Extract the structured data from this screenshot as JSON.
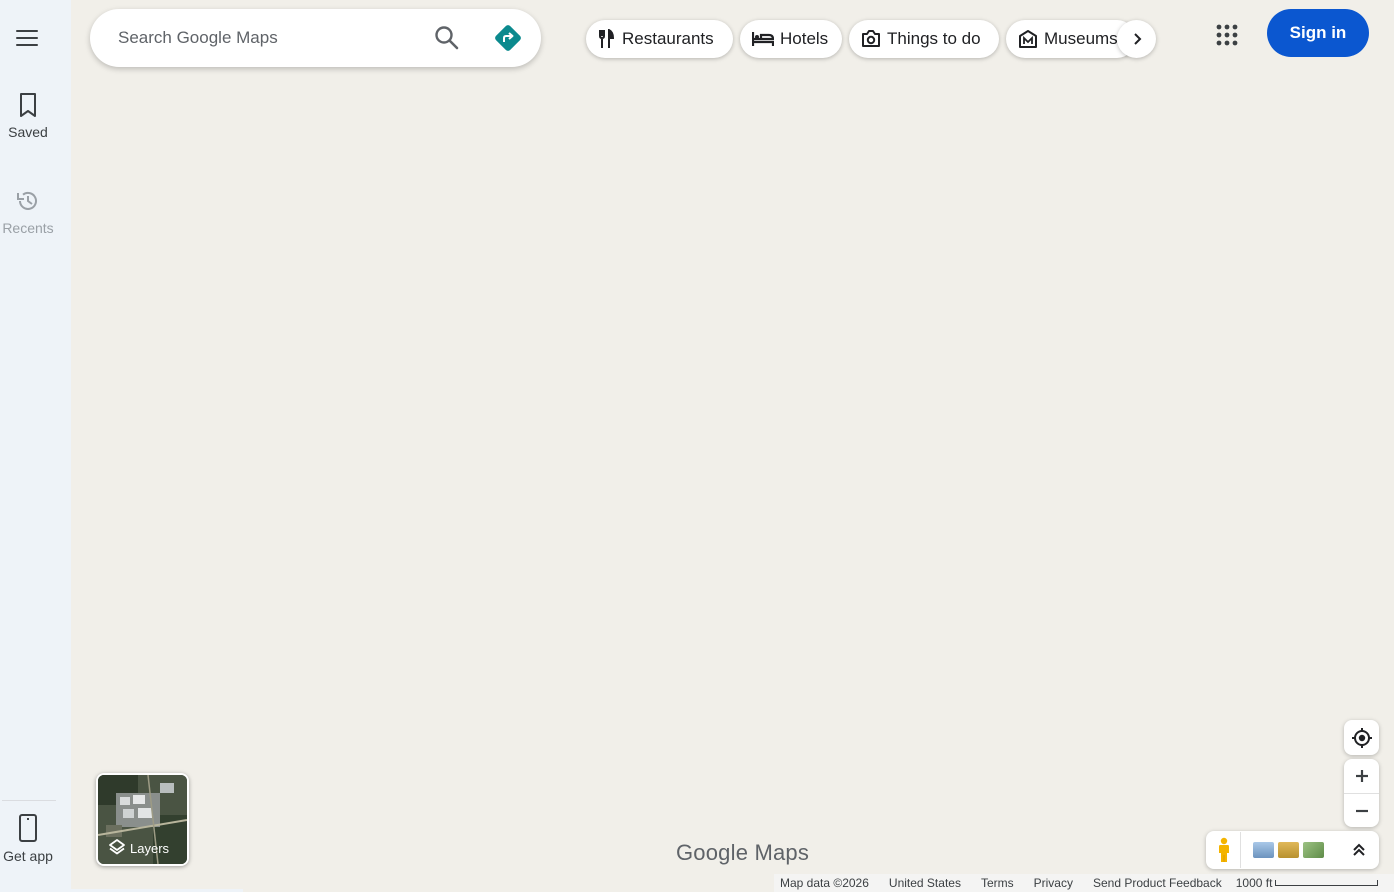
{
  "sidebar": {
    "saved_label": "Saved",
    "recents_label": "Recents",
    "getapp_label": "Get app"
  },
  "search": {
    "placeholder": "Search Google Maps"
  },
  "chips": [
    {
      "label": "Restaurants",
      "icon": "fork-knife-icon"
    },
    {
      "label": "Hotels",
      "icon": "bed-icon"
    },
    {
      "label": "Things to do",
      "icon": "camera-icon"
    },
    {
      "label": "Museums",
      "icon": "museum-icon"
    }
  ],
  "header": {
    "signin_label": "Sign in"
  },
  "layers": {
    "label": "Layers"
  },
  "logo": {
    "text": "Google Maps"
  },
  "footer": {
    "map_data": "Map data ©2026",
    "country": "United States",
    "terms": "Terms",
    "privacy": "Privacy",
    "feedback": "Send Product Feedback",
    "scale": "1000 ft"
  },
  "colors": {
    "map_bg": "#f1efe9",
    "rail_bg": "#eef3f8",
    "signin_bg": "#0b57d0",
    "directions": "#0b8a8e"
  }
}
